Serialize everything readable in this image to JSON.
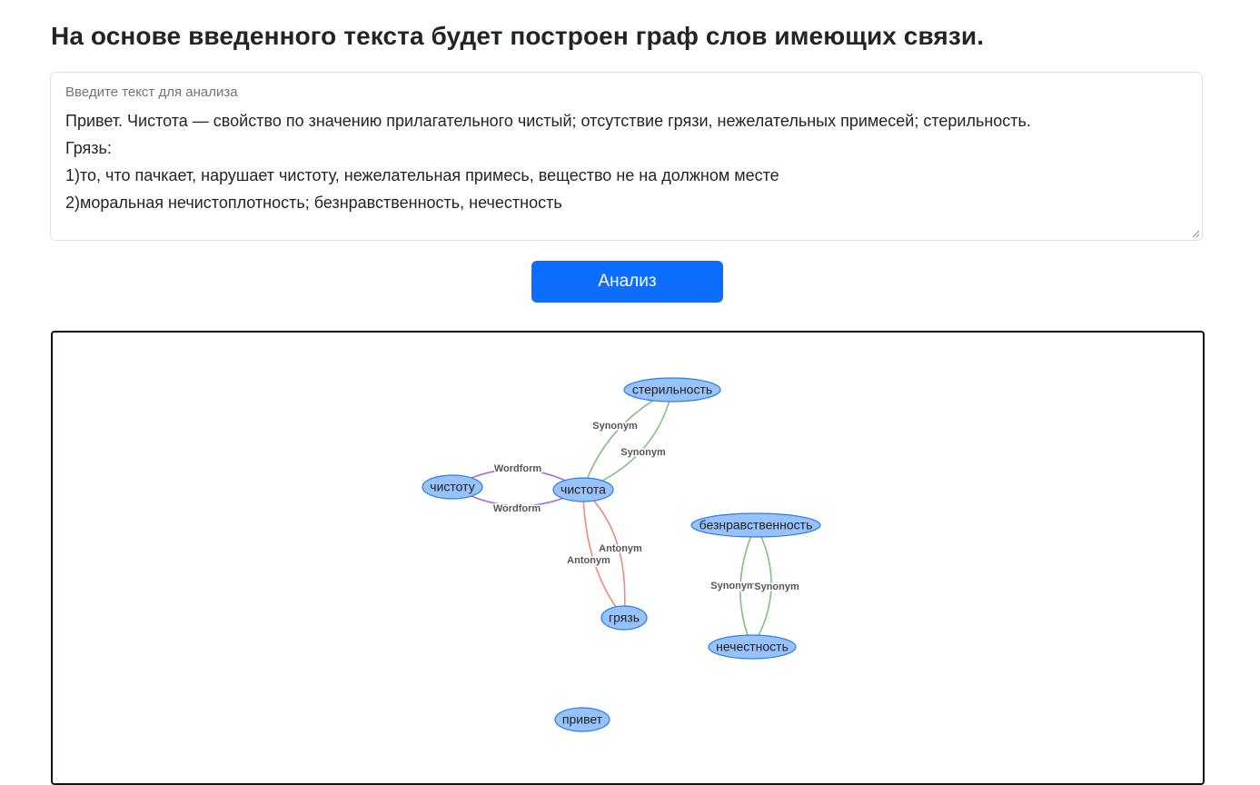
{
  "header": {
    "title": "На основе введенного текста будет построен граф слов имеющих связи."
  },
  "input": {
    "label": "Введите текст для анализа",
    "lines": [
      "Привет. Чистота — свойство по значению прилагательного чистый; отсутствие грязи, нежелательных примесей; стерильность.",
      "Грязь:",
      "1)то, что пачкает, нарушает чистоту, нежелательная примесь, вещество не на должном месте",
      "2)моральная нечистоплотность; безнравственность, нечестность"
    ]
  },
  "actions": {
    "analyze_label": "Анализ"
  },
  "colors": {
    "node_fill": "#97c2fc",
    "node_border": "#2b7ce9",
    "synonym": "#80c080",
    "wordform": "#a868e0",
    "antonym": "#ec8a80",
    "button": "#0d6efd"
  },
  "graph": {
    "nodes": [
      {
        "id": "sterilnost",
        "label": "стерильность"
      },
      {
        "id": "chistotu",
        "label": "чистоту"
      },
      {
        "id": "chistota",
        "label": "чистота"
      },
      {
        "id": "beznravstvennost",
        "label": "безнравственность"
      },
      {
        "id": "gryaz",
        "label": "грязь"
      },
      {
        "id": "nechestnost",
        "label": "нечестность"
      },
      {
        "id": "privet",
        "label": "привет"
      }
    ],
    "edges": [
      {
        "from": "chistota",
        "to": "sterilnost",
        "label": "Synonym",
        "type": "synonym"
      },
      {
        "from": "sterilnost",
        "to": "chistota",
        "label": "Synonym",
        "type": "synonym"
      },
      {
        "from": "chistotu",
        "to": "chistota",
        "label": "Wordform",
        "type": "wordform"
      },
      {
        "from": "chistota",
        "to": "chistotu",
        "label": "Wordform",
        "type": "wordform"
      },
      {
        "from": "chistota",
        "to": "gryaz",
        "label": "Antonym",
        "type": "antonym"
      },
      {
        "from": "gryaz",
        "to": "chistota",
        "label": "Antonym",
        "type": "antonym"
      },
      {
        "from": "beznravstvennost",
        "to": "nechestnost",
        "label": "Synonym",
        "type": "synonym"
      },
      {
        "from": "nechestnost",
        "to": "beznravstvennost",
        "label": "Synonym",
        "type": "synonym"
      }
    ]
  }
}
